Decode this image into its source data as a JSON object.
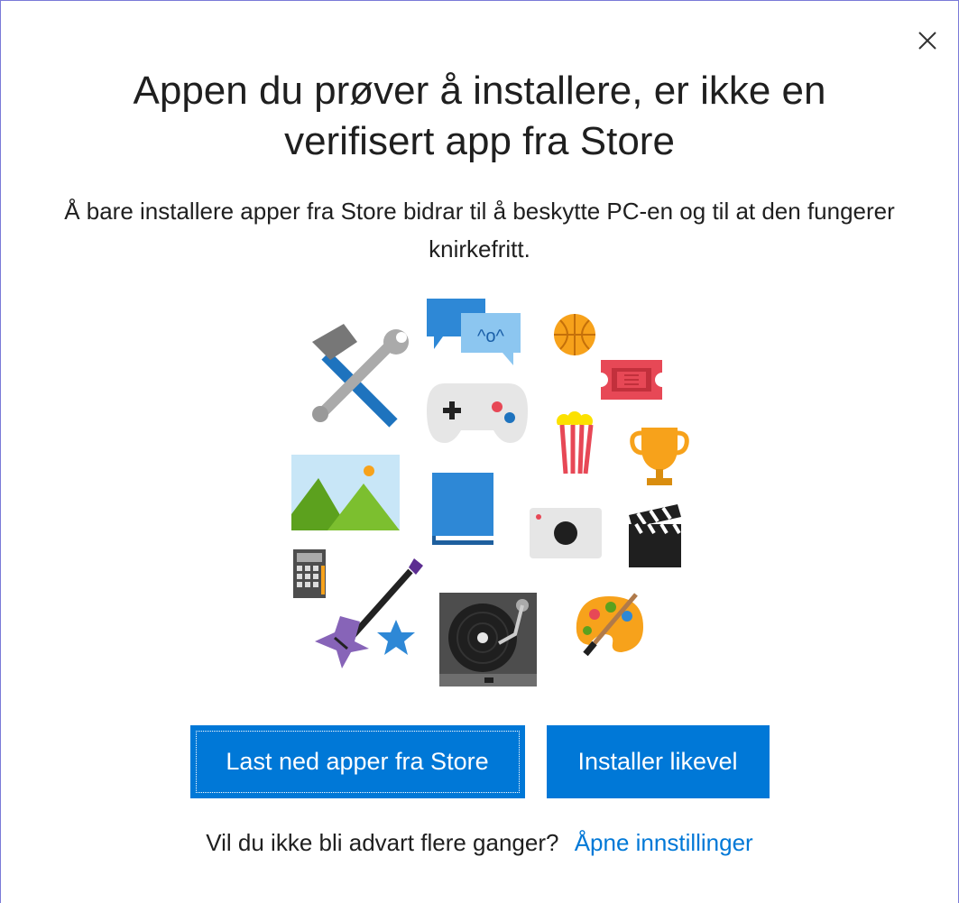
{
  "dialog": {
    "close_icon": "close-icon",
    "title": "Appen du prøver å installere, er ikke en verifisert app fra Store",
    "description": "Å bare installere apper fra Store bidrar til å beskytte PC-en og til at den fungerer knirkefritt.",
    "illustration": {
      "icons": [
        "tools-icon",
        "chat-icon",
        "basketball-icon",
        "ticket-icon",
        "gamepad-icon",
        "popcorn-icon",
        "trophy-icon",
        "photo-icon",
        "book-icon",
        "camera-icon",
        "clapperboard-icon",
        "calculator-icon",
        "guitar-icon",
        "star-icon",
        "turntable-icon",
        "palette-icon"
      ],
      "chat_text": "^o^"
    },
    "buttons": {
      "store": "Last ned apper fra Store",
      "install": "Installer likevel"
    },
    "footer": {
      "question": "Vil du ikke bli advart flere ganger?",
      "link": "Åpne innstillinger"
    },
    "colors": {
      "accent": "#0078d7",
      "border": "#7a7ad8"
    }
  }
}
